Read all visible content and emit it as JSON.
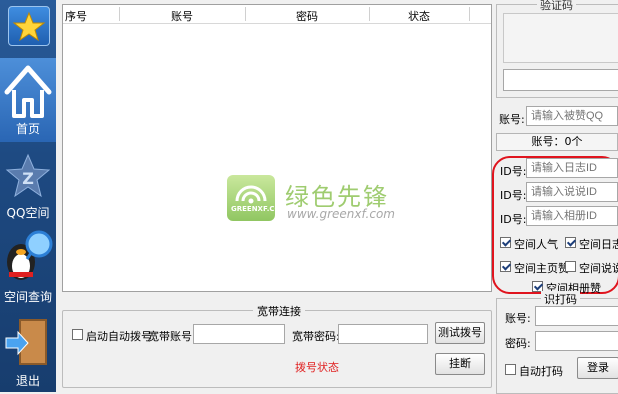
{
  "sidebar": {
    "items": [
      {
        "label": "首页"
      },
      {
        "label": "QQ空间"
      },
      {
        "label": "空间查询"
      },
      {
        "label": "退出"
      }
    ]
  },
  "table": {
    "columns": [
      "序号",
      "账号",
      "密码",
      "状态"
    ]
  },
  "watermark": {
    "brand": "绿色先锋",
    "url": "www.greenxf.com",
    "logo_text": "GREENXF.COM"
  },
  "broadband": {
    "title": "宽带连接",
    "auto_dial_label": "启动自动拨号",
    "auto_dial_checked": false,
    "account_label": "宽带账号:",
    "account_value": "",
    "password_label": "宽带密码:",
    "password_value": "",
    "test_button": "测试拨号",
    "hangup_button": "挂断",
    "status_text": "拨号状态"
  },
  "captcha": {
    "title": "验证码",
    "input_value": ""
  },
  "target": {
    "account_label": "账号:",
    "account_placeholder": "请输入被赞QQ",
    "count_text": "账号：0个"
  },
  "ids": {
    "diary_label": "ID号:",
    "diary_placeholder": "请输入日志ID",
    "talk_label": "ID号:",
    "talk_placeholder": "请输入说说ID",
    "album_label": "ID号:",
    "album_placeholder": "请输入相册ID"
  },
  "options": [
    {
      "label": "空间人气",
      "checked": true
    },
    {
      "label": "空间日志",
      "checked": true
    },
    {
      "label": "空间主页赞",
      "checked": true
    },
    {
      "label": "空间说说",
      "checked": false
    },
    {
      "label": "空间相册赞",
      "checked": true
    }
  ],
  "print": {
    "title": "识打码",
    "account_label": "账号:",
    "password_label": "密码:",
    "auto_print_label": "自动打码",
    "auto_print_checked": false,
    "login_button": "登录"
  },
  "colors": {
    "sidebar": "#1e4a82",
    "highlight_oval": "#e0141e",
    "status_red": "#e02020"
  }
}
